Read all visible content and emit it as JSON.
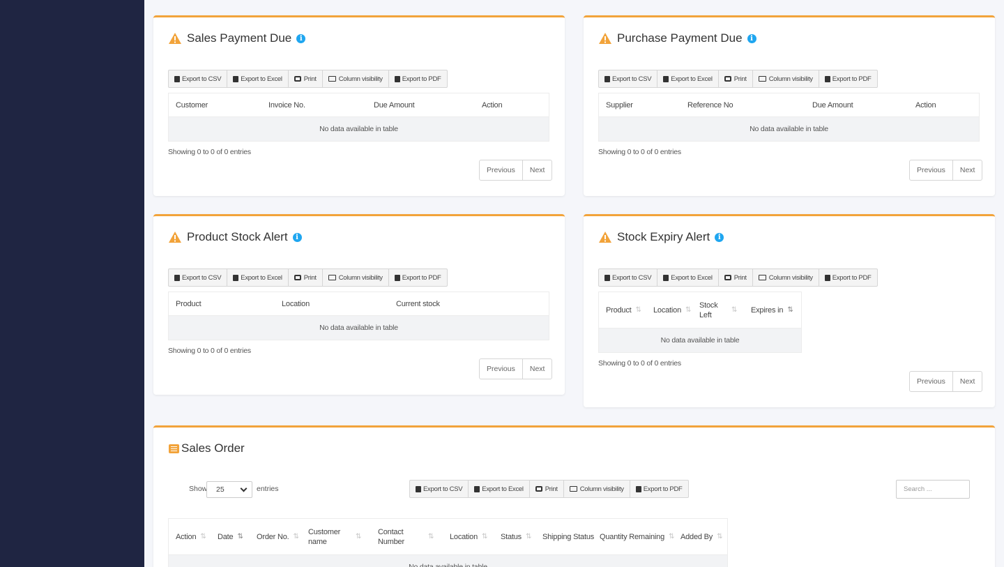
{
  "colors": {
    "accent": "#f2a33a",
    "sidebar": "#1f2542",
    "info": "#1fa6f0"
  },
  "export_buttons": {
    "csv": "Export to CSV",
    "excel": "Export to Excel",
    "print": "Print",
    "colvis": "Column visibility",
    "pdf": "Export to PDF"
  },
  "empty_text": "No data available in table",
  "showing_text": "Showing 0 to 0 of 0 entries",
  "pager": {
    "previous": "Previous",
    "next": "Next"
  },
  "sales_payment_due": {
    "title": "Sales Payment Due",
    "columns": [
      "Customer",
      "Invoice No.",
      "Due Amount",
      "Action"
    ]
  },
  "purchase_payment_due": {
    "title": "Purchase Payment Due",
    "columns": [
      "Supplier",
      "Reference No",
      "Due Amount",
      "Action"
    ]
  },
  "product_stock_alert": {
    "title": "Product Stock Alert",
    "columns": [
      "Product",
      "Location",
      "Current stock"
    ]
  },
  "stock_expiry_alert": {
    "title": "Stock Expiry Alert",
    "columns": [
      "Product",
      "Location",
      "Stock Left",
      "Expires in"
    ]
  },
  "sales_order": {
    "title": "Sales Order",
    "show_label": "Show",
    "entries_label": "entries",
    "page_size": "25",
    "search_placeholder": "Search ...",
    "columns": [
      "Action",
      "Date",
      "Order No.",
      "Customer name",
      "Contact Number",
      "Location",
      "Status",
      "Shipping Status",
      "Quantity Remaining",
      "Added By"
    ]
  }
}
